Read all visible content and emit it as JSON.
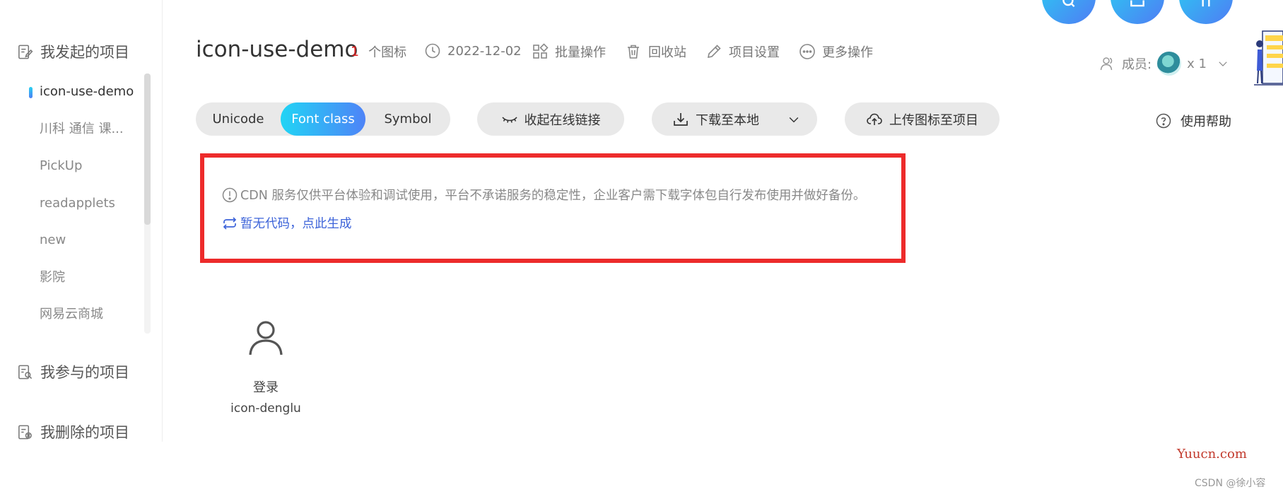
{
  "sidebar": {
    "my_projects_label": "我发起的项目",
    "items": [
      {
        "label": "icon-use-demo"
      },
      {
        "label": "川科 通信 课..."
      },
      {
        "label": "PickUp"
      },
      {
        "label": "readapplets"
      },
      {
        "label": "new"
      },
      {
        "label": "影院"
      },
      {
        "label": "网易云商城"
      }
    ],
    "joined_projects_label": "我参与的项目",
    "deleted_projects_label": "我删除的项目"
  },
  "header": {
    "title": "icon-use-demo",
    "icon_count": "1",
    "icon_count_unit": "个图标",
    "date": "2022-12-02",
    "batch_label": "批量操作",
    "recycle_label": "回收站",
    "settings_label": "项目设置",
    "more_label": "更多操作",
    "members_label": "成员:",
    "members_count": "x 1"
  },
  "toolbar": {
    "tabs": [
      {
        "label": "Unicode"
      },
      {
        "label": "Font class"
      },
      {
        "label": "Symbol"
      }
    ],
    "collapse_label": "收起在线链接",
    "download_label": "下载至本地",
    "upload_label": "上传图标至项目",
    "help_label": "使用帮助"
  },
  "notice": {
    "text": "CDN 服务仅供平台体验和调试使用，平台不承诺服务的稳定性，企业客户需下载字体包自行发布使用并做好备份。",
    "generate_link": "暂无代码，点此生成"
  },
  "icons": [
    {
      "name": "登录",
      "code": "icon-denglu",
      "glyph": "user-icon"
    }
  ],
  "watermark": {
    "site": "Yuucn.com",
    "author": "CSDN @徐小容"
  },
  "colors": {
    "accent_start": "#21d4f5",
    "accent_end": "#4e83f7",
    "highlight_border": "#ed2b2b",
    "link": "#3c63d9",
    "count": "#e02020"
  }
}
